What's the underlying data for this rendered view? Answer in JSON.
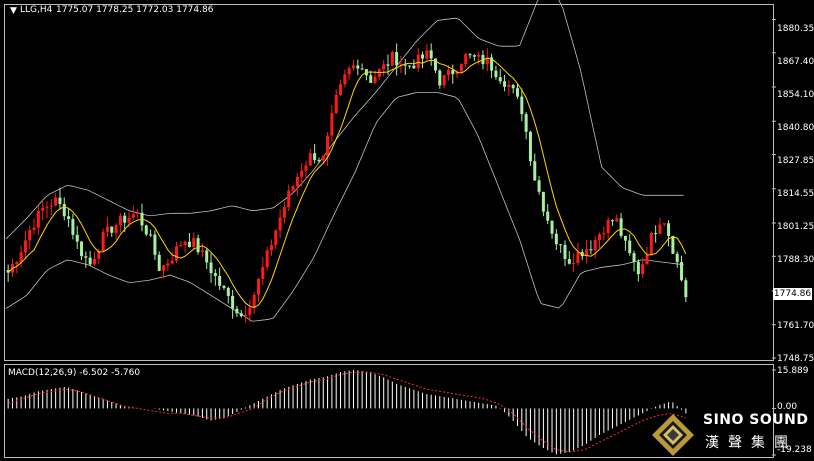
{
  "chart_header": {
    "symbol": "LLG,H4",
    "ohlc": "1775.07 1778.25 1772.03 1774.86"
  },
  "current_price_label": "1774.86",
  "chart_data": [
    {
      "type": "candlestick",
      "title": "LLG,H4",
      "ylim": [
        1748.75,
        1886.0
      ],
      "y_ticks": [
        "1880.35",
        "1867.40",
        "1854.10",
        "1840.80",
        "1827.85",
        "1814.55",
        "1801.25",
        "1788.30",
        "1774.86",
        "1761.70",
        "1748.75"
      ],
      "indicators": [
        "Bollinger Bands",
        "Moving Average (yellow)"
      ],
      "close_path": [
        1782,
        1790,
        1800,
        1807,
        1810,
        1805,
        1792,
        1785,
        1795,
        1800,
        1803,
        1805,
        1797,
        1783,
        1788,
        1795,
        1793,
        1786,
        1778,
        1771,
        1765,
        1773,
        1786,
        1800,
        1812,
        1822,
        1828,
        1826,
        1848,
        1860,
        1864,
        1857,
        1861,
        1866,
        1862,
        1864,
        1867,
        1856,
        1860,
        1866,
        1865,
        1864,
        1859,
        1854,
        1845,
        1820,
        1805,
        1793,
        1787,
        1790,
        1793,
        1800,
        1803,
        1790,
        1782,
        1795,
        1805,
        1790,
        1773
      ],
      "bands": {
        "upper_path": [
          1795,
          1803,
          1812,
          1816,
          1814,
          1810,
          1806,
          1804,
          1805,
          1805,
          1806,
          1808,
          1806,
          1807,
          1813,
          1822,
          1833,
          1843,
          1852,
          1862,
          1872,
          1880,
          1881,
          1873,
          1870,
          1870,
          1890,
          1888,
          1860,
          1823,
          1815,
          1812,
          1812,
          1812
        ],
        "lower_path": [
          1768,
          1773,
          1783,
          1787,
          1785,
          1781,
          1778,
          1779,
          1781,
          1778,
          1773,
          1768,
          1763,
          1764,
          1775,
          1788,
          1805,
          1821,
          1840,
          1850,
          1852,
          1852,
          1850,
          1835,
          1815,
          1795,
          1770,
          1768,
          1782,
          1784,
          1785,
          1787,
          1786,
          1785
        ]
      },
      "current_price": 1774.86
    },
    {
      "type": "histogram",
      "title": "MACD(12,26,9) -6.502 -5.760",
      "indicator": "MACD",
      "params": "12,26,9",
      "values": {
        "macd": -6.502,
        "signal": -5.76
      },
      "ylim": [
        -19.238,
        15.889
      ],
      "y_ticks": [
        "15.889",
        "0.00",
        "-19.238"
      ],
      "histogram_path": [
        4,
        5,
        7,
        8,
        9,
        7,
        5,
        3,
        1,
        0,
        0,
        -1,
        -2,
        -3,
        -5,
        -4,
        -1,
        2,
        5,
        8,
        10,
        12,
        13,
        15,
        16,
        15,
        13,
        10,
        8,
        6,
        5,
        4,
        3,
        2,
        1,
        -5,
        -12,
        -16,
        -19,
        -18,
        -15,
        -11,
        -8,
        -5,
        -2,
        1,
        3,
        -2
      ],
      "signal_path": [
        2,
        4,
        6,
        7,
        8,
        7,
        5,
        3,
        1,
        0,
        -1,
        -2,
        -2,
        -3,
        -4,
        -4,
        -2,
        0,
        4,
        7,
        9,
        11,
        12,
        14,
        15,
        15,
        14,
        12,
        10,
        8,
        7,
        6,
        5,
        4,
        2,
        -2,
        -8,
        -13,
        -17,
        -18,
        -17,
        -14,
        -11,
        -8,
        -5,
        -3,
        -2,
        -4
      ]
    }
  ],
  "logo": {
    "text_en": "SINO SOUND",
    "text_cn": "漢聲集團"
  },
  "colors": {
    "background": "#000000",
    "bull_candle": "#ff1a1a",
    "bear_candle": "#a6f0a6",
    "moving_average": "#ffd400",
    "bands": "#bfbfbf",
    "macd_hist": "#ffffff",
    "macd_signal": "#ff2a2a"
  }
}
